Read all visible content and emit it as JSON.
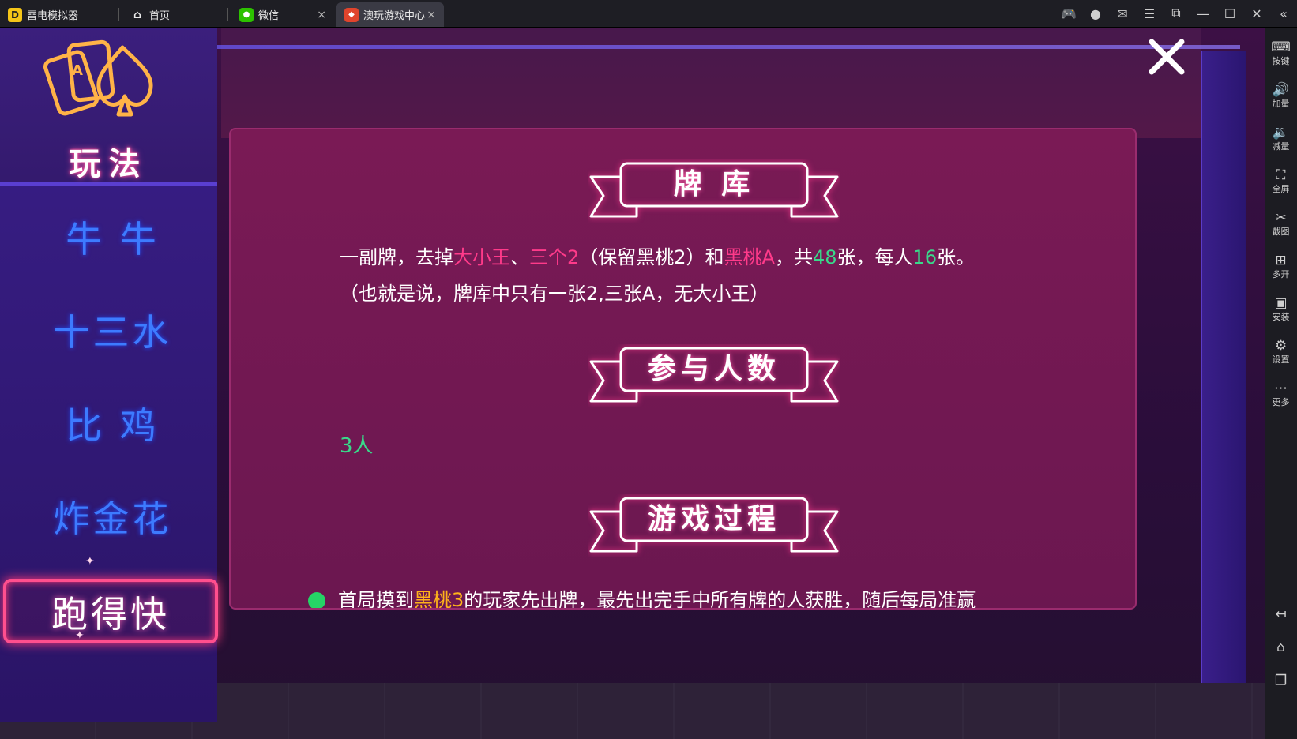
{
  "titlebar": {
    "tabs": [
      {
        "label": "雷电模拟器",
        "icon": "leidian-logo-icon"
      },
      {
        "label": "首页",
        "icon": "home-icon"
      },
      {
        "label": "微信",
        "icon": "wechat-icon"
      },
      {
        "label": "澳玩游戏中心",
        "icon": "game-center-icon"
      }
    ],
    "close_glyph": "×"
  },
  "toolbar": [
    {
      "label": "按键",
      "icon": "keyboard-icon",
      "glyph": "⌨"
    },
    {
      "label": "加量",
      "icon": "volume-up-icon",
      "glyph": "🔊"
    },
    {
      "label": "减量",
      "icon": "volume-down-icon",
      "glyph": "🔉"
    },
    {
      "label": "全屏",
      "icon": "fullscreen-icon",
      "glyph": "⛶"
    },
    {
      "label": "截图",
      "icon": "scissors-icon",
      "glyph": "✂"
    },
    {
      "label": "多开",
      "icon": "multi-instance-icon",
      "glyph": "⊞"
    },
    {
      "label": "安装",
      "icon": "apk-icon",
      "glyph": "▣"
    },
    {
      "label": "设置",
      "icon": "gear-icon",
      "glyph": "⚙"
    },
    {
      "label": "更多",
      "icon": "more-icon",
      "glyph": "⋯"
    }
  ],
  "left_menu": {
    "title": "玩法",
    "items": [
      "牛 牛",
      "十三水",
      "比 鸡",
      "炸金花",
      "跑得快"
    ],
    "active_index": 4
  },
  "sections": {
    "deck": {
      "title": "牌 库",
      "line1": {
        "a": "一副牌，去掉",
        "b": "大小王",
        "c": "、",
        "d": "三个2",
        "e": "（保留黑桃2）和",
        "f": "黑桃A",
        "g": "，共",
        "h": "48",
        "i": "张，每人",
        "j": "16",
        "k": "张。"
      },
      "line2": "（也就是说，牌库中只有一张2,三张A，无大小王）"
    },
    "players": {
      "title": "参与人数",
      "value": "3人"
    },
    "process": {
      "title": "游戏过程",
      "line1": {
        "a": "首局摸到",
        "b": "黑桃3",
        "c": "的玩家先出牌，最先出完手中所有牌的人获胜，随后每局准赢"
      }
    }
  }
}
